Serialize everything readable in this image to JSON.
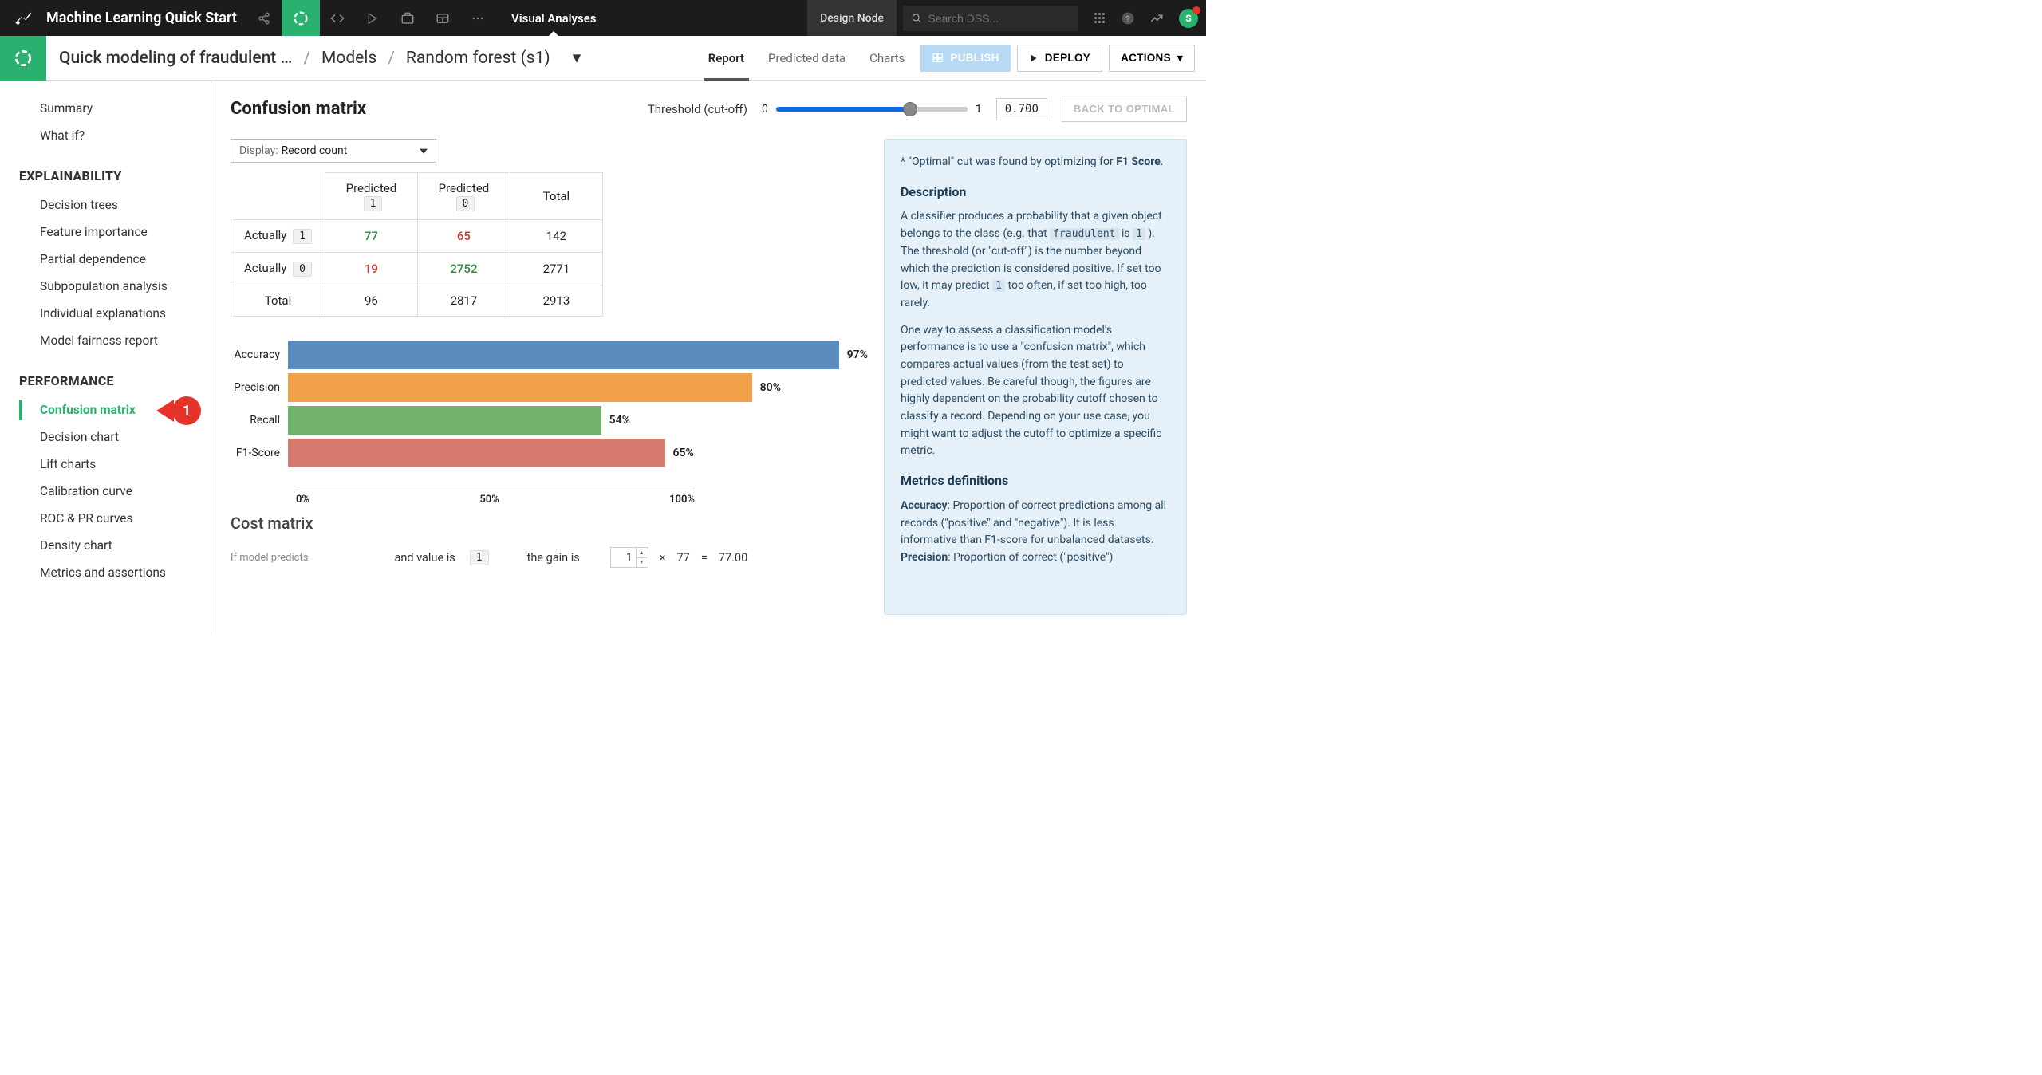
{
  "topbar": {
    "project_title": "Machine Learning Quick Start",
    "active_tab": "Visual Analyses",
    "design_node": "Design Node",
    "search_placeholder": "Search DSS...",
    "avatar_initial": "S"
  },
  "breadcrumbs": {
    "items": [
      "Quick modeling of fraudulent …",
      "Models",
      "Random forest (s1)"
    ]
  },
  "subnav": {
    "items": [
      "Report",
      "Predicted data",
      "Charts"
    ],
    "active": "Report"
  },
  "buttons": {
    "publish": "PUBLISH",
    "deploy": "DEPLOY",
    "actions": "ACTIONS"
  },
  "sidenav": {
    "top": [
      "Summary",
      "What if?"
    ],
    "explainability_label": "EXPLAINABILITY",
    "explainability": [
      "Decision trees",
      "Feature importance",
      "Partial dependence",
      "Subpopulation analysis",
      "Individual explanations",
      "Model fairness report"
    ],
    "performance_label": "PERFORMANCE",
    "performance": [
      "Confusion matrix",
      "Decision chart",
      "Lift charts",
      "Calibration curve",
      "ROC & PR curves",
      "Density chart",
      "Metrics and assertions"
    ],
    "active": "Confusion matrix"
  },
  "annotation": {
    "num": "1"
  },
  "main": {
    "title": "Confusion matrix",
    "threshold_label": "Threshold (cut-off)",
    "threshold_min": "0",
    "threshold_max": "1",
    "threshold_value": "0.700",
    "threshold_pct": 70,
    "back_to_optimal": "BACK TO OPTIMAL",
    "display_label": "Display:",
    "display_value": "Record count"
  },
  "confusion": {
    "col_headers": [
      "Predicted",
      "Predicted",
      "Total"
    ],
    "col_chips": [
      "1",
      "0"
    ],
    "row_labels": [
      "Actually",
      "Actually",
      "Total"
    ],
    "row_chips": [
      "1",
      "0"
    ],
    "cells": [
      {
        "v": "77",
        "c": "val-green"
      },
      {
        "v": "65",
        "c": "val-red"
      },
      {
        "v": "142",
        "c": ""
      },
      {
        "v": "19",
        "c": "val-red"
      },
      {
        "v": "2752",
        "c": "val-green"
      },
      {
        "v": "2771",
        "c": ""
      },
      {
        "v": "96",
        "c": ""
      },
      {
        "v": "2817",
        "c": ""
      },
      {
        "v": "2913",
        "c": ""
      }
    ]
  },
  "chart_data": {
    "type": "bar",
    "orientation": "horizontal",
    "categories": [
      "Accuracy",
      "Precision",
      "Recall",
      "F1-Score"
    ],
    "values": [
      97,
      80,
      54,
      65
    ],
    "labels": [
      "97%",
      "80%",
      "54%",
      "65%"
    ],
    "colors": [
      "#5a8cc0",
      "#f2a24b",
      "#71b36c",
      "#d77a70"
    ],
    "xlabel": "",
    "ylabel": "",
    "xlim": [
      0,
      100
    ],
    "ticks": [
      "0%",
      "50%",
      "100%"
    ]
  },
  "cost": {
    "title": "Cost matrix",
    "predict_intro": "If model predicts",
    "and_value_is": "and value is",
    "gain_is": "the gain is",
    "value_chip": "1",
    "gain_input": "1",
    "times": "×",
    "mult": "77",
    "eq": "=",
    "result": "77.00"
  },
  "info": {
    "top_note_pre": "* \"Optimal\" cut was found by optimizing for ",
    "top_note_bold": "F1 Score",
    "top_note_post": ".",
    "desc_h": "Description",
    "desc_1a": "A classifier produces a probability that a given object belongs to the class (e.g. that ",
    "desc_1_m1": "fraudulent",
    "desc_1b": " is ",
    "desc_1_m2": "1",
    "desc_1c": " ). The threshold (or \"cut-off\") is the number beyond which the prediction is considered positive. If set too low, it may predict ",
    "desc_1_m3": "1",
    "desc_1d": " too often, if set too high, too rarely.",
    "desc_2": "One way to assess a classification model's performance is to use a \"confusion matrix\", which compares actual values (from the test set) to predicted values. Be careful though, the figures are highly dependent on the probability cutoff chosen to classify a record. Depending on your use case, you might want to adjust the cutoff to optimize a specific metric.",
    "metrics_h": "Metrics definitions",
    "acc_b": "Accuracy",
    "acc_t": ": Proportion of correct predictions among all records (\"positive\" and \"negative\"). It is less informative than F1-score for unbalanced datasets.",
    "prec_b": "Precision",
    "prec_t": ": Proportion of correct (\"positive\")"
  }
}
